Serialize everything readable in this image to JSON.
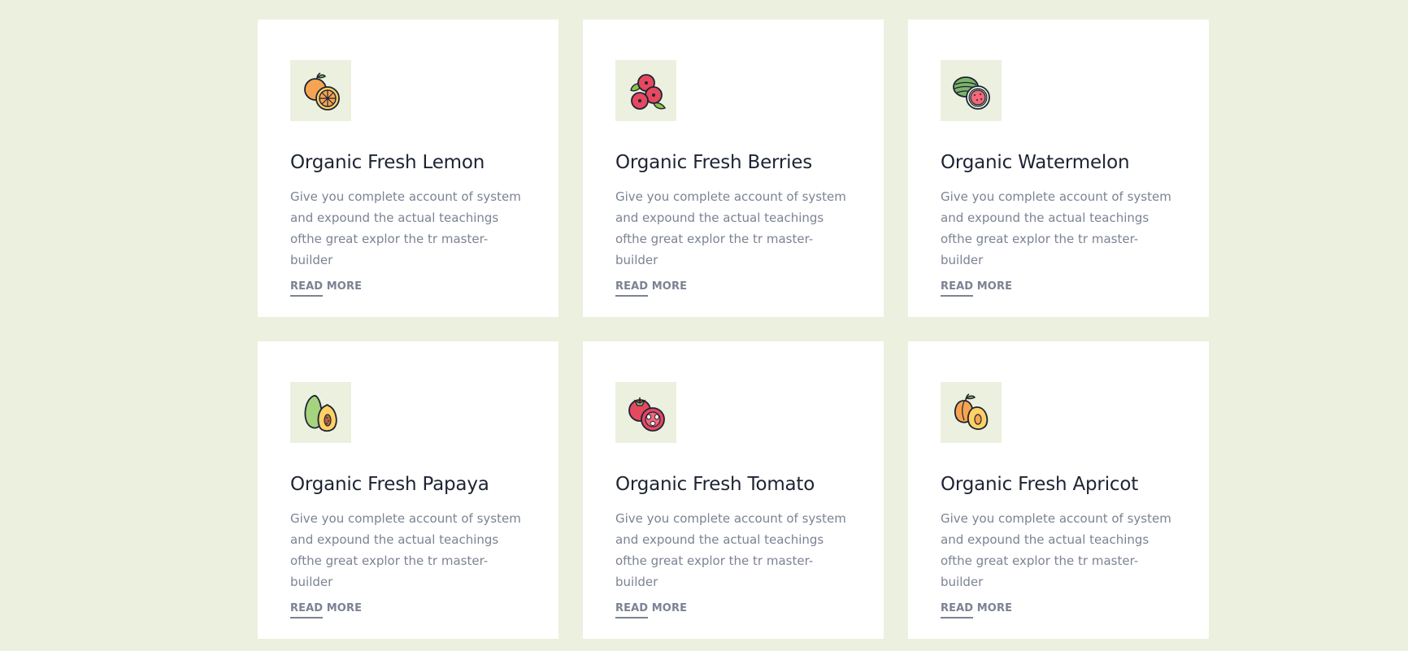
{
  "colors": {
    "page_background": "#ecf0df",
    "card_background": "#ffffff",
    "icon_background": "#ecf0df",
    "title": "#1d2433",
    "text": "#7b8393"
  },
  "cards": [
    {
      "icon": "orange-icon",
      "title": "Organic Fresh Lemon",
      "description": "Give you complete account of system and expound the actual teachings ofthe great explor the tr master-builder",
      "link_label": "READ MORE"
    },
    {
      "icon": "berries-icon",
      "title": "Organic Fresh Berries",
      "description": "Give you complete account of system and expound the actual teachings ofthe great explor the tr master-builder",
      "link_label": "READ MORE"
    },
    {
      "icon": "watermelon-icon",
      "title": "Organic Watermelon",
      "description": "Give you complete account of system and expound the actual teachings ofthe great explor the tr master-builder",
      "link_label": "READ MORE"
    },
    {
      "icon": "papaya-icon",
      "title": "Organic Fresh Papaya",
      "description": "Give you complete account of system and expound the actual teachings ofthe great explor the tr master-builder",
      "link_label": "READ MORE"
    },
    {
      "icon": "tomato-icon",
      "title": "Organic Fresh Tomato",
      "description": "Give you complete account of system and expound the actual teachings ofthe great explor the tr master-builder",
      "link_label": "READ MORE"
    },
    {
      "icon": "apricot-icon",
      "title": "Organic Fresh Apricot",
      "description": "Give you complete account of system and expound the actual teachings ofthe great explor the tr master-builder",
      "link_label": "READ MORE"
    }
  ]
}
